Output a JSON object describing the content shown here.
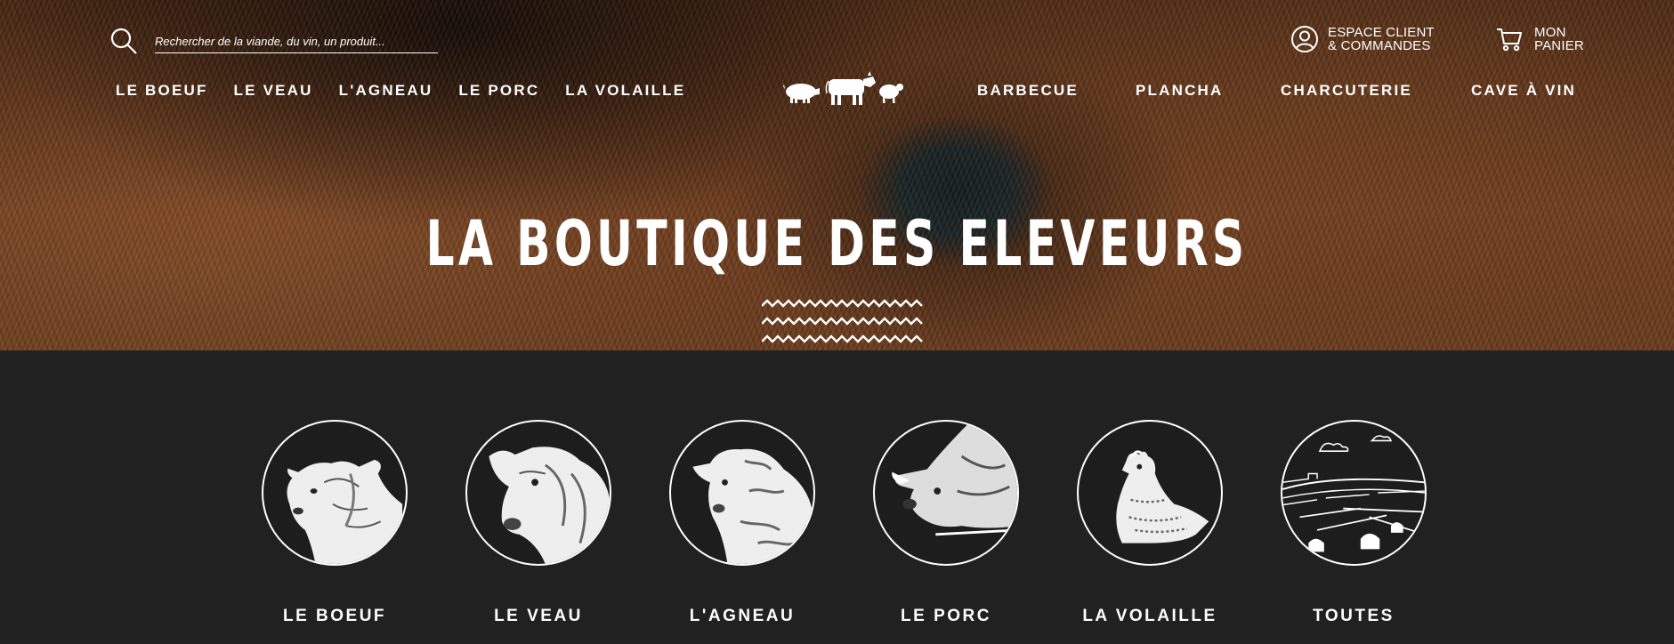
{
  "search": {
    "placeholder": "Rechercher de la viande, du vin, un produit..."
  },
  "account": {
    "line1": "ESPACE CLIENT",
    "line2": "& COMMANDES",
    "icon": "user-circle-icon"
  },
  "cart": {
    "line1": "MON",
    "line2": "PANIER",
    "icon": "cart-icon"
  },
  "nav_left": [
    "LE BOEUF",
    "LE VEAU",
    "L'AGNEAU",
    "LE PORC",
    "LA VOLAILLE"
  ],
  "nav_right": [
    "BARBECUE",
    "PLANCHA",
    "CHARCUTERIE",
    "CAVE À VIN"
  ],
  "hero": {
    "title": "LA BOUTIQUE DES ELEVEURS"
  },
  "categories": [
    {
      "label": "LE BOEUF",
      "icon": "bull-icon"
    },
    {
      "label": "LE VEAU",
      "icon": "calf-icon"
    },
    {
      "label": "L'AGNEAU",
      "icon": "sheep-icon"
    },
    {
      "label": "LE PORC",
      "icon": "pig-icon"
    },
    {
      "label": "LA VOLAILLE",
      "icon": "hen-icon"
    },
    {
      "label": "TOUTES",
      "icon": "farm-landscape-icon"
    }
  ],
  "colors": {
    "section_bg": "#212121",
    "text": "#ffffff",
    "hero_tone": "#7a4322"
  }
}
